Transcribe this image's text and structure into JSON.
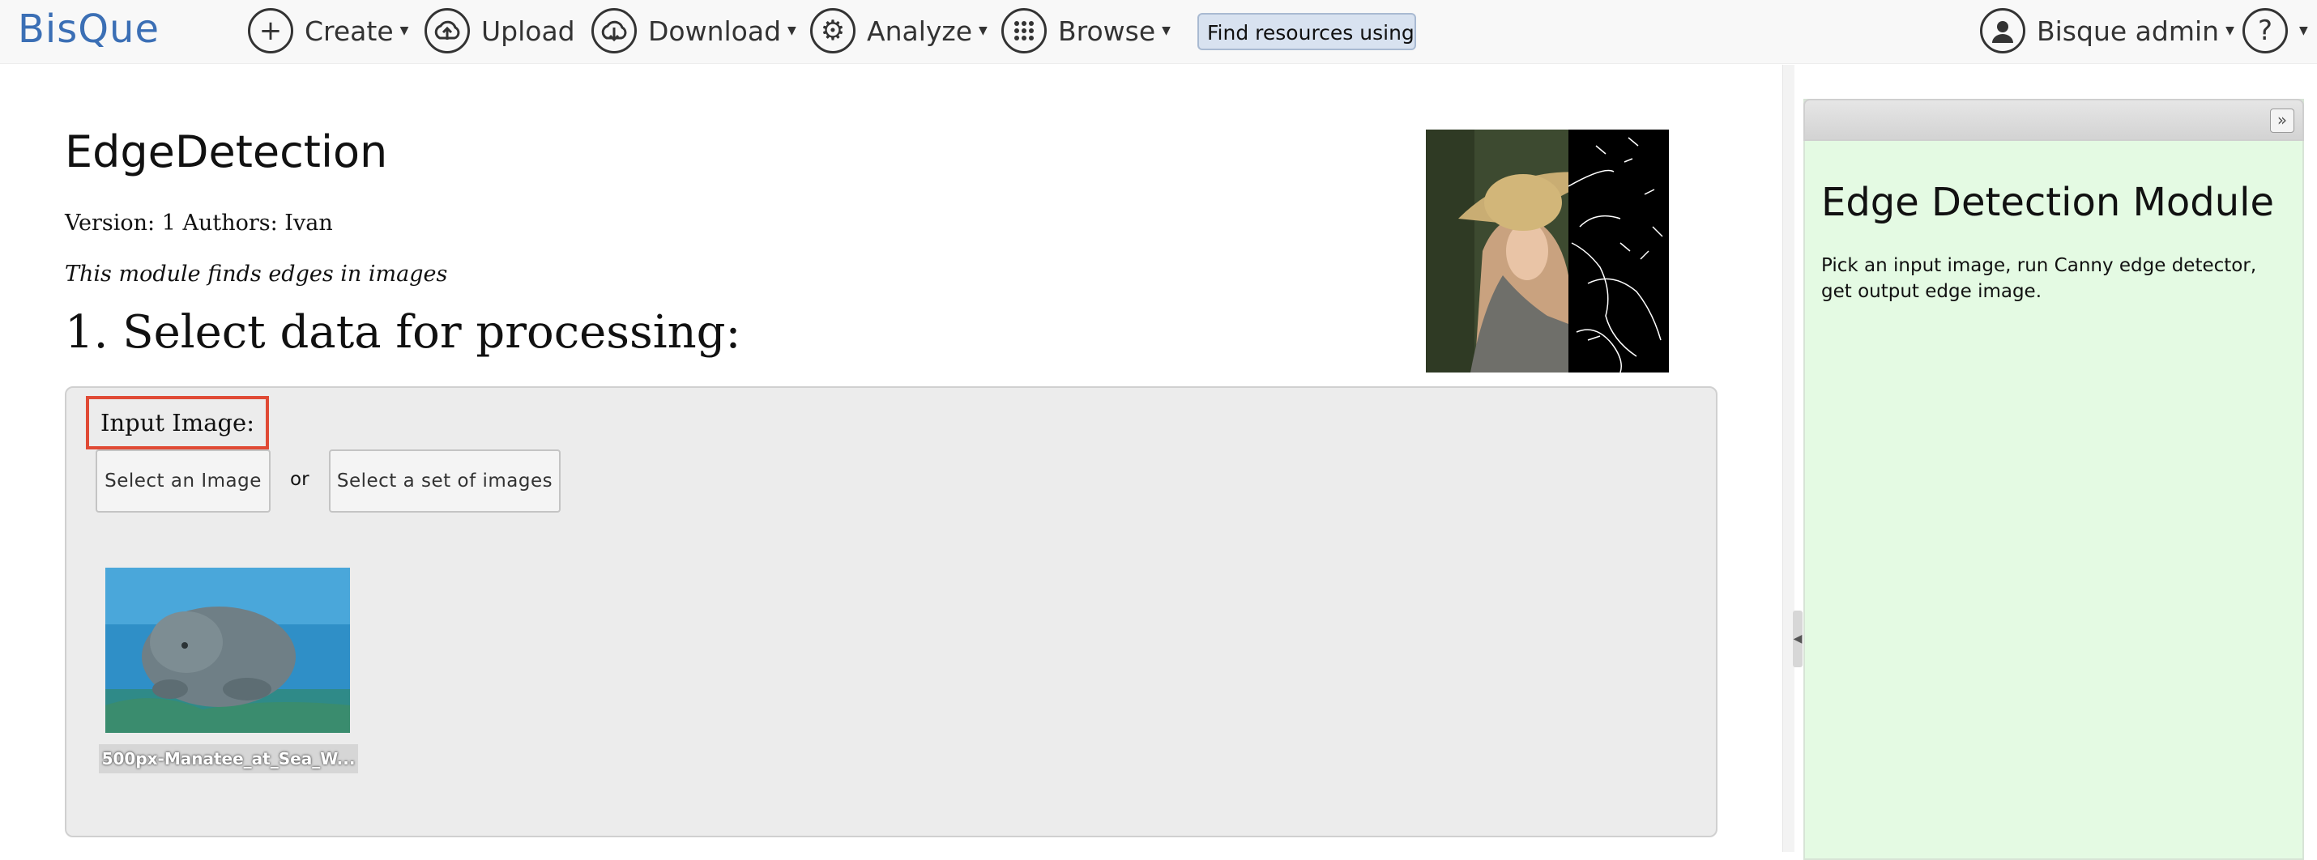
{
  "nav": {
    "logo": "BisQue",
    "items": [
      {
        "label": "Create",
        "icon": "plus-circle-icon"
      },
      {
        "label": "Upload",
        "icon": "upload-cloud-icon"
      },
      {
        "label": "Download",
        "icon": "download-cloud-icon"
      },
      {
        "label": "Analyze",
        "icon": "gears-icon"
      },
      {
        "label": "Browse",
        "icon": "grid-dots-icon"
      }
    ],
    "search_placeholder": "Find resources using tag",
    "user_label": "Bisque admin",
    "help_symbol": "?"
  },
  "module": {
    "title": "EdgeDetection",
    "meta": "Version: 1 Authors: Ivan",
    "description": "This module finds edges in images"
  },
  "section": {
    "heading": "1. Select data for processing:",
    "input_label": "Input Image:",
    "select_image_btn": "Select an Image",
    "or_text": "or",
    "select_set_btn": "Select a set of images",
    "thumbnail_caption": "500px-Manatee_at_Sea_W..."
  },
  "right_panel": {
    "title": "Edge Detection Module",
    "text": "Pick an input image, run Canny edge detector, get output edge image."
  },
  "colors": {
    "highlight_border": "#e04a35",
    "right_panel_bg": "#e4fae3",
    "search_bg": "#d8e2f0"
  }
}
